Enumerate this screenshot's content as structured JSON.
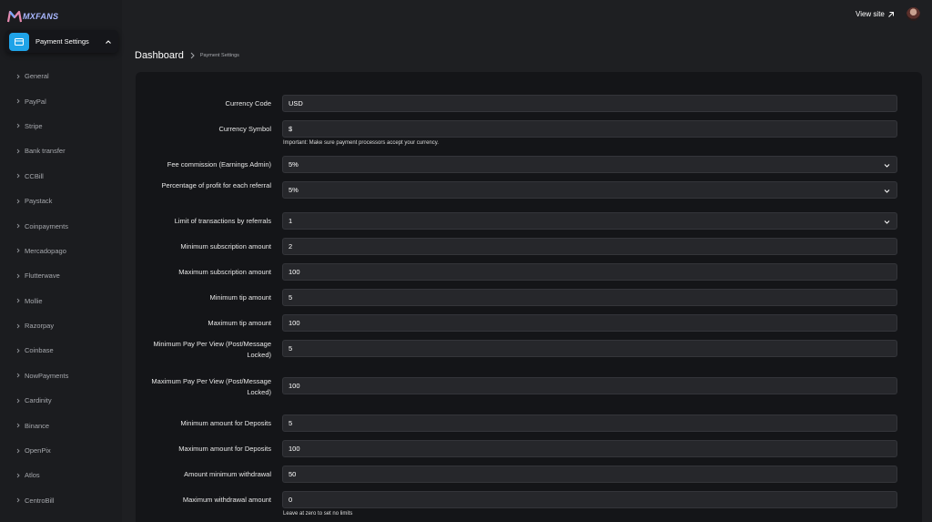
{
  "brand": {
    "name": "MXFANS",
    "accent": "#a9b7ff",
    "active_icon_color": "#1fa3e8"
  },
  "sidebar": {
    "section_title": "Payment Settings",
    "items": [
      {
        "label": "General"
      },
      {
        "label": "PayPal"
      },
      {
        "label": "Stripe"
      },
      {
        "label": "Bank transfer"
      },
      {
        "label": "CCBill"
      },
      {
        "label": "Paystack"
      },
      {
        "label": "Coinpayments"
      },
      {
        "label": "Mercadopago"
      },
      {
        "label": "Flutterwave"
      },
      {
        "label": "Mollie"
      },
      {
        "label": "Razorpay"
      },
      {
        "label": "Coinbase"
      },
      {
        "label": "NowPayments"
      },
      {
        "label": "Cardinity"
      },
      {
        "label": "Binance"
      },
      {
        "label": "OpenPix"
      },
      {
        "label": "Atlos"
      },
      {
        "label": "CentroBill"
      }
    ]
  },
  "topbar": {
    "view_site": "View site"
  },
  "breadcrumb": {
    "root": "Dashboard",
    "current": "Payment Settings"
  },
  "form": {
    "fields": [
      {
        "label": "Currency Code",
        "value": "USD",
        "type": "input"
      },
      {
        "label": "Currency Symbol",
        "value": "$",
        "type": "input",
        "help": "Important: Make sure payment processors accept your currency."
      },
      {
        "label": "Fee commission (Earnings Admin)",
        "value": "5%",
        "type": "select"
      },
      {
        "label": "Percentage of profit for each referral",
        "value": "5%",
        "type": "select"
      },
      {
        "label": "Limit of transactions by referrals",
        "value": "1",
        "type": "select"
      },
      {
        "label": "Minimum subscription amount",
        "value": "2",
        "type": "input"
      },
      {
        "label": "Maximum subscription amount",
        "value": "100",
        "type": "input"
      },
      {
        "label": "Minimum tip amount",
        "value": "5",
        "type": "input"
      },
      {
        "label": "Maximum tip amount",
        "value": "100",
        "type": "input"
      },
      {
        "label": "Minimum Pay Per View (Post/Message Locked)",
        "value": "5",
        "type": "input"
      },
      {
        "label": "Maximum Pay Per View (Post/Message Locked)",
        "value": "100",
        "type": "input"
      },
      {
        "label": "Minimum amount for Deposits",
        "value": "5",
        "type": "input"
      },
      {
        "label": "Maximum amount for Deposits",
        "value": "100",
        "type": "input"
      },
      {
        "label": "Amount minimum withdrawal",
        "value": "50",
        "type": "input"
      },
      {
        "label": "Maximum withdrawal amount",
        "value": "0",
        "type": "input",
        "help": "Leave at zero to set no limits"
      }
    ]
  }
}
